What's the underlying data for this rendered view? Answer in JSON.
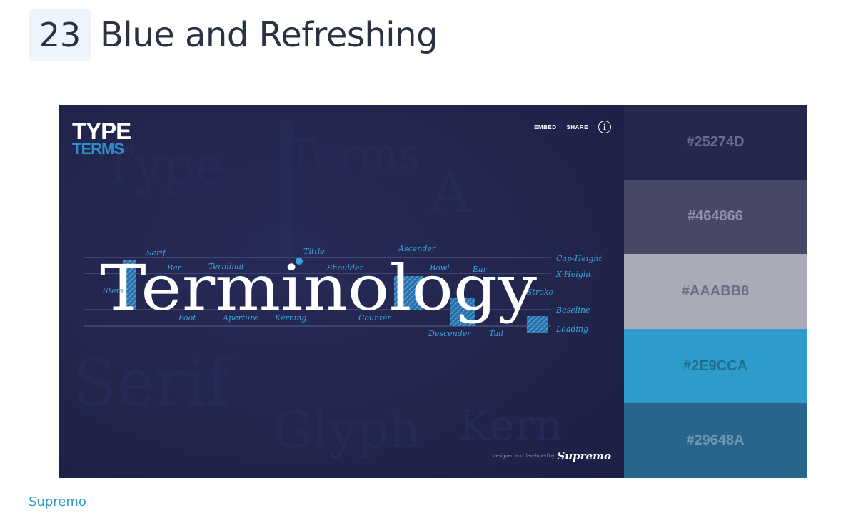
{
  "header": {
    "number": "23",
    "title": "Blue and Refreshing"
  },
  "screenshot": {
    "logo_line1": "TYPE",
    "logo_line2": "TERMS",
    "nav": {
      "embed": "EMBED",
      "share": "SHARE",
      "info": "i"
    },
    "hero_word": "Terminology",
    "terms": {
      "serif": "Serif",
      "tittle": "Tittle",
      "ascender": "Ascender",
      "cap_height": "Cap-Height",
      "bar": "Bar",
      "terminal": "Terminal",
      "shoulder": "Shoulder",
      "bowl": "Bowl",
      "ear": "Ear",
      "x_height": "X-Height",
      "stem": "Stem",
      "stroke": "Stroke",
      "baseline": "Baseline",
      "foot": "Foot",
      "aperture": "Aperture",
      "kerning": "Kerning",
      "counter": "Counter",
      "descender": "Descender",
      "tail": "Tail",
      "leading": "Leading"
    },
    "credit_text": "designed and developed by",
    "credit_brand": "Supremo"
  },
  "palette": [
    {
      "hex": "#25274D",
      "text_color": "#6a6d8e"
    },
    {
      "hex": "#464866",
      "text_color": "#8d8fa6"
    },
    {
      "hex": "#AAABB8",
      "text_color": "#6e6f80"
    },
    {
      "hex": "#2E9CCA",
      "text_color": "#1d6f92"
    },
    {
      "hex": "#29648A",
      "text_color": "#6f98b2"
    }
  ],
  "colors": {
    "accent": "#2E9CCA",
    "label_blue": "#3aa3dd",
    "guide": "#5a5f8c"
  },
  "source_link": "Supremo"
}
